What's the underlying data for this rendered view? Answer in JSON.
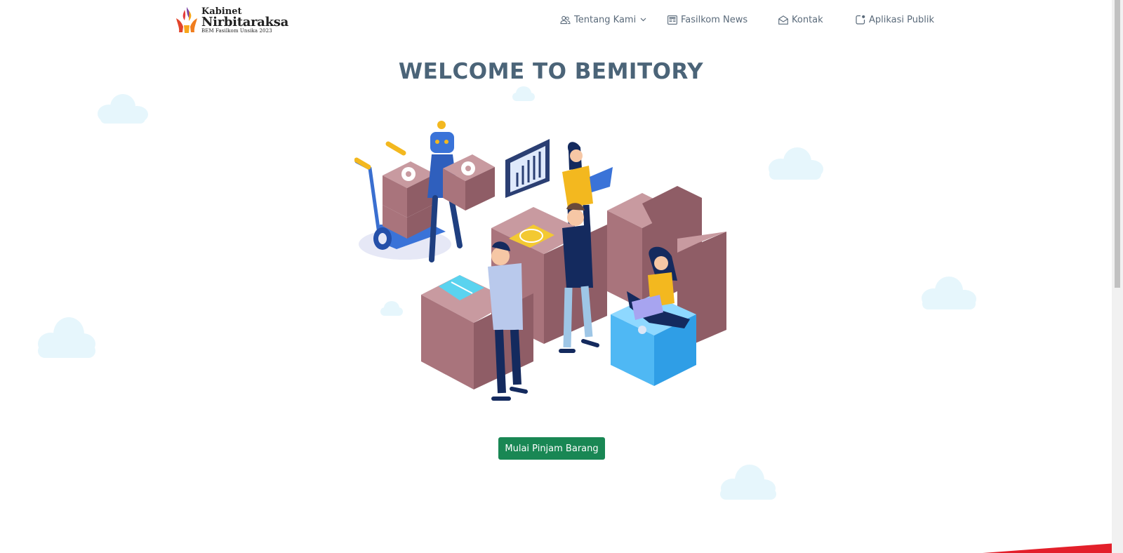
{
  "logo": {
    "line1": "Kabinet",
    "line2": "Nirbitaraksa",
    "line3": "BEM Fasilkom Unsika 2023"
  },
  "nav": {
    "items": [
      {
        "label": "Tentang Kami",
        "icon": "users-icon",
        "has_dropdown": true
      },
      {
        "label": "Fasilkom News",
        "icon": "newspaper-icon"
      },
      {
        "label": "Kontak",
        "icon": "envelope-open-icon"
      },
      {
        "label": "Aplikasi Publik",
        "icon": "app-indicator-icon"
      }
    ]
  },
  "hero": {
    "title": "WELCOME TO BEMITORY",
    "cta_label": "Mulai Pinjam Barang"
  },
  "colors": {
    "title": "#4b6478",
    "cta": "#198754",
    "nav_text": "#5a6a7a",
    "cloud": "#e6f6fc",
    "box": "#a9747c",
    "accent_red": "#e3202a"
  }
}
